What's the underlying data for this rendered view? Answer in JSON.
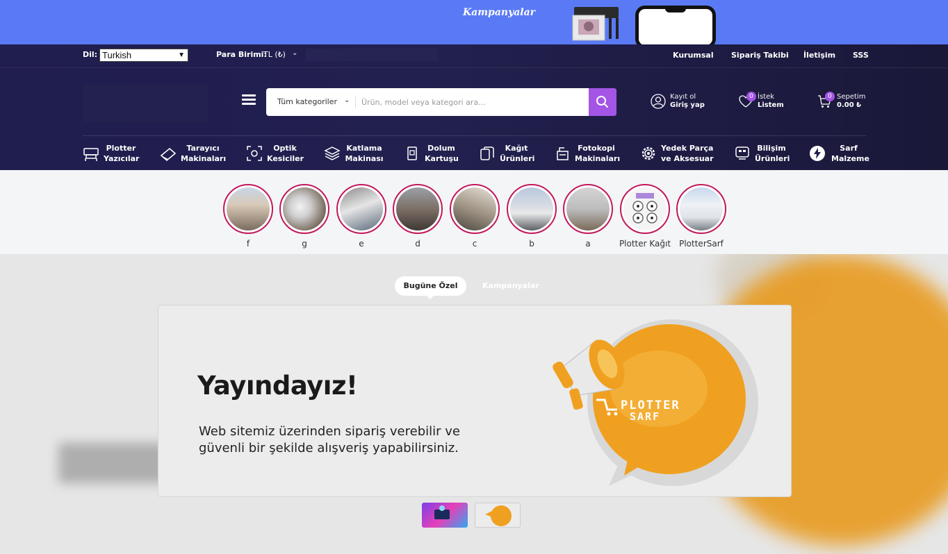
{
  "promo": {
    "text": "Kampanyalar"
  },
  "topbar": {
    "language_label": "Dil:",
    "language_value": "Turkish",
    "currency_label": "Para Birimi:",
    "currency_value": "TL (₺)",
    "links": [
      "Kurumsal",
      "Sipariş Takibi",
      "İletişim",
      "SSS"
    ]
  },
  "search": {
    "category": "Tüm kategoriler",
    "placeholder": "Ürün, model veya kategori ara..."
  },
  "account": {
    "line1": "Kayıt ol",
    "line2": "Giriş yap"
  },
  "wishlist": {
    "line1": "İstek",
    "line2": "Listem",
    "count": "0"
  },
  "cart": {
    "line1": "Sepetim",
    "line2": "0.00 ₺",
    "count": "0"
  },
  "nav": [
    {
      "line1": "Plotter",
      "line2": "Yazıcılar",
      "icon": "plotter-icon"
    },
    {
      "line1": "Tarayıcı",
      "line2": "Makinaları",
      "icon": "scanner-icon"
    },
    {
      "line1": "Optik",
      "line2": "Kesiciler",
      "icon": "optical-cutter-icon"
    },
    {
      "line1": "Katlama",
      "line2": "Makinası",
      "icon": "layers-icon"
    },
    {
      "line1": "Dolum",
      "line2": "Kartuşu",
      "icon": "cartridge-icon"
    },
    {
      "line1": "Kağıt",
      "line2": "Ürünleri",
      "icon": "paper-icon"
    },
    {
      "line1": "Fotokopi",
      "line2": "Makinaları",
      "icon": "photocopier-icon"
    },
    {
      "line1": "Yedek Parça",
      "line2": "ve Aksesuar",
      "icon": "gear-icon"
    },
    {
      "line1": "Bilişim",
      "line2": "Ürünleri",
      "icon": "computer-icon"
    },
    {
      "line1": "Sarf",
      "line2": "Malzeme",
      "icon": "lightning-icon"
    }
  ],
  "stories": [
    "f",
    "g",
    "e",
    "d",
    "c",
    "b",
    "a",
    "Plotter Kağıt",
    "PlotterSarf"
  ],
  "tabs": {
    "active": "Bugüne Özel",
    "inactive": "Kampanyalar"
  },
  "slide": {
    "title": "Yayındayız!",
    "line1": "Web sitemiz üzerinden sipariş verebilir ve",
    "line2": "güvenli bir şekilde alışveriş yapabilirsiniz.",
    "logo_line1": "PLOTTER",
    "logo_line2": "SARF"
  },
  "colors": {
    "accent": "#a455e6",
    "promo": "#5a7af5",
    "header": "#201d4f",
    "story_ring": "#c2185b",
    "bubble": "#f0a020"
  }
}
